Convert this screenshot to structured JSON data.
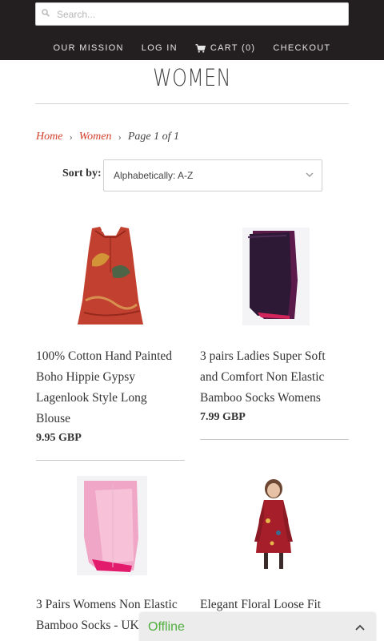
{
  "header": {
    "search": {
      "placeholder": "Search...",
      "value": ""
    },
    "nav": [
      {
        "label": "OUR MISSION"
      },
      {
        "label": "LOG IN"
      },
      {
        "label": "CART (0)",
        "icon": "cart-icon"
      },
      {
        "label": "CHECKOUT"
      }
    ]
  },
  "page": {
    "title": "WOMEN",
    "breadcrumb": {
      "home": "Home",
      "section": "Women",
      "page": "Page 1 of 1"
    },
    "sort": {
      "label": "Sort by:",
      "selected": "Alphabetically: A-Z"
    }
  },
  "products": [
    {
      "name_lines": [
        "100% Cotton Hand Painted",
        "Boho Hippie Gypsy",
        "Lagenlook Style Long",
        "Blouse"
      ],
      "price": "9.95 GBP"
    },
    {
      "name_lines": [
        "3 pairs Ladies Super Soft",
        "and Comfort Non Elastic",
        "Bamboo Socks Womens"
      ],
      "price": "7.99 GBP"
    },
    {
      "name_lines": [
        "3 Pairs Womens Non Elastic",
        "Bamboo Socks - UK"
      ],
      "price": ""
    },
    {
      "name_lines": [
        "Elegant Floral Loose Fit"
      ],
      "price": ""
    }
  ],
  "status": {
    "offline_label": "Offline"
  },
  "colors": {
    "header_bg": "#231f20",
    "accent_link": "#d23d2a",
    "offline_text": "#4fae3e"
  }
}
